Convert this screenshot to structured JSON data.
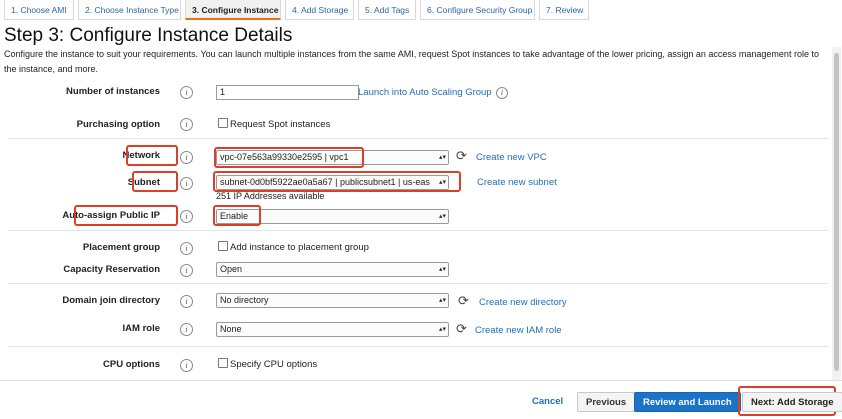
{
  "wizard": {
    "tabs": [
      {
        "label": "1. Choose AMI"
      },
      {
        "label": "2. Choose Instance Type"
      },
      {
        "label": "3. Configure Instance"
      },
      {
        "label": "4. Add Storage"
      },
      {
        "label": "5. Add Tags"
      },
      {
        "label": "6. Configure Security Group"
      },
      {
        "label": "7. Review"
      }
    ],
    "active_tab": "3. Configure Instance"
  },
  "page": {
    "title": "Step 3: Configure Instance Details",
    "description": "Configure the instance to suit your requirements. You can launch multiple instances from the same AMI, request Spot instances to take advantage of the lower pricing, assign an access management role to the instance, and more."
  },
  "form": {
    "number_of_instances": {
      "label": "Number of instances",
      "value": "1",
      "link": "Launch into Auto Scaling Group"
    },
    "purchasing_option": {
      "label": "Purchasing option",
      "checkbox_label": "Request Spot instances",
      "checked": false
    },
    "network": {
      "label": "Network",
      "value": "vpc-07e563a99330e2595 | vpc1",
      "link": "Create new VPC"
    },
    "subnet": {
      "label": "Subnet",
      "value": "subnet-0d0bf5922ae0a5a67 | publicsubnet1 | us-eas",
      "link": "Create new subnet",
      "helper": "251 IP Addresses available"
    },
    "auto_assign_public_ip": {
      "label": "Auto-assign Public IP",
      "value": "Enable"
    },
    "placement_group": {
      "label": "Placement group",
      "checkbox_label": "Add instance to placement group",
      "checked": false
    },
    "capacity_reservation": {
      "label": "Capacity Reservation",
      "value": "Open"
    },
    "domain_join_directory": {
      "label": "Domain join directory",
      "value": "No directory",
      "link": "Create new directory"
    },
    "iam_role": {
      "label": "IAM role",
      "value": "None",
      "link": "Create new IAM role"
    },
    "cpu_options": {
      "label": "CPU options",
      "checkbox_label": "Specify CPU options",
      "checked": false
    }
  },
  "icons": {
    "info": "i",
    "refresh": "⟳",
    "dropdown": "▲▼"
  },
  "footer": {
    "cancel": "Cancel",
    "previous": "Previous",
    "review_and_launch": "Review and Launch",
    "next": "Next: Add Storage"
  },
  "colors": {
    "accent": "#ec7211",
    "link": "#1f6fb5",
    "primary_button": "#1a73c9",
    "highlight": "#d93f2b"
  }
}
